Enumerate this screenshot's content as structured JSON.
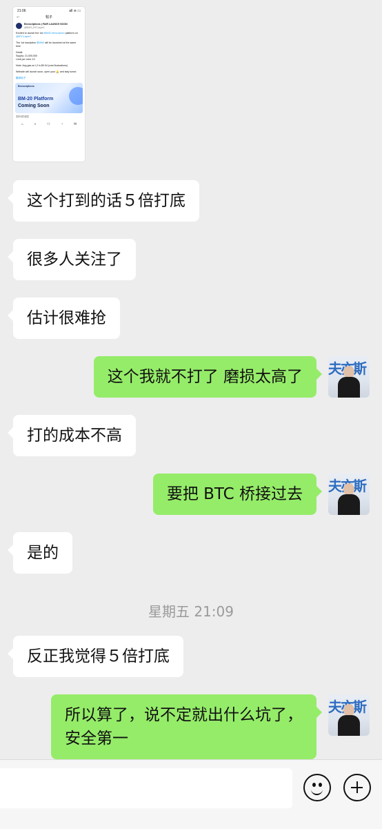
{
  "shared_screenshot": {
    "status_time": "21:06",
    "status_icons": "all ≋ ▭",
    "title": "帖子",
    "account_name": "Bevscriptions | FAIR LAUNCH SOON",
    "account_handle": "@BM20_BTCLayer2",
    "paragraphs": [
      {
        "parts": [
          {
            "t": "Excited to launch the 1st "
          },
          {
            "t": "#BM20 #inscription",
            "link": true
          },
          {
            "t": " platform on "
          },
          {
            "t": "@BTCLayer2",
            "link": true
          }
        ]
      },
      {
        "parts": [
          {
            "t": "The 1st inscription "
          },
          {
            "t": "$BMW",
            "link": true
          },
          {
            "t": " will be launched at the same time."
          }
        ]
      },
      {
        "parts": [
          {
            "t": "Detail:\nSupply: 21,000,000\nLimit per mint: 10"
          }
        ]
      },
      {
        "parts": [
          {
            "t": "Note: Avg gas on L2 is $0.04 (cost fluctuations)"
          }
        ]
      },
      {
        "parts": [
          {
            "t": "Website will launch soon, open your 🔔 and stay tuned"
          }
        ]
      }
    ],
    "translate": "翻译帖子",
    "banner_brand": "Bevscriptions",
    "banner_line1": "BM-20 Platform",
    "banner_line2": "Coming Soon",
    "footer": "发布你的回复",
    "tab_icons": [
      "⌂",
      "⌕",
      "⚇",
      "◔",
      "✉"
    ]
  },
  "messages": [
    {
      "side": "left",
      "text": "这个打到的话５倍打底"
    },
    {
      "side": "left",
      "text": "很多人关注了"
    },
    {
      "side": "left",
      "text": "估计很难抢"
    },
    {
      "side": "right",
      "text": "这个我就不打了 磨损太高了"
    },
    {
      "side": "left",
      "text": "打的成本不高"
    },
    {
      "side": "right",
      "text": "要把 BTC 桥接过去"
    },
    {
      "side": "left",
      "text": "是的"
    },
    {
      "side": "left",
      "text": "反正我觉得５倍打底"
    },
    {
      "side": "right",
      "text": "所以算了，说不定就出什么坑了，\n安全第一"
    }
  ],
  "timestamp": "星期五 21:09",
  "avatar_text": "夫亦斯",
  "input": {
    "emoji_icon": "emoji-icon",
    "plus_icon": "plus-icon"
  },
  "colors": {
    "chat_background": "#ededed",
    "bubble_self": "#95ec69",
    "bubble_other": "#ffffff",
    "link": "#1d9bf0"
  }
}
